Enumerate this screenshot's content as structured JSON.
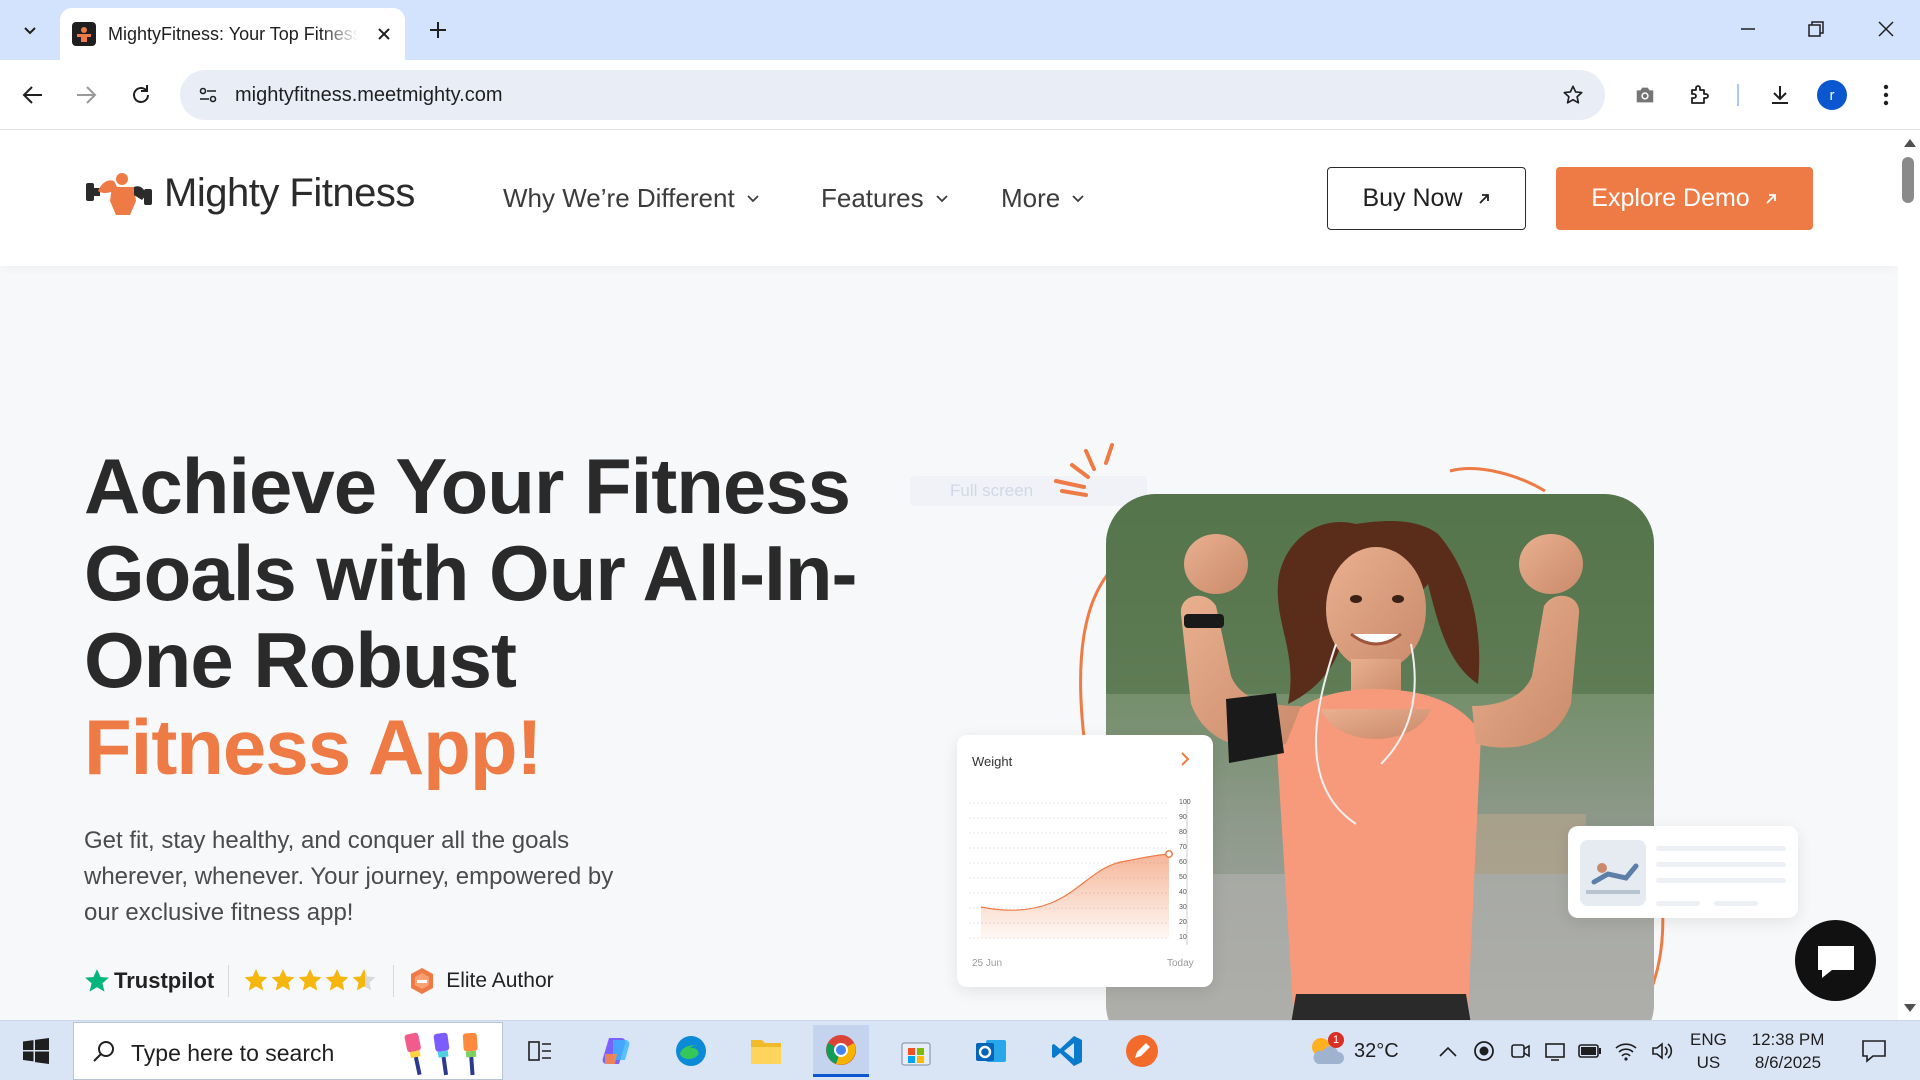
{
  "browser": {
    "tab_title": "MightyFitness: Your Top Fitness App",
    "url": "mightyfitness.meetmighty.com",
    "avatar_letter": "r"
  },
  "site": {
    "logo_text": "Mighty Fitness",
    "nav": [
      {
        "label": "Why We’re Different"
      },
      {
        "label": "Features"
      },
      {
        "label": "More"
      }
    ],
    "buy_now_label": "Buy Now",
    "explore_demo_label": "Explore Demo",
    "accent_color": "#ee7b45"
  },
  "hero": {
    "title_line1": "Achieve Your Fitness Goals with Our All-In-One Robust",
    "title_accent": "Fitness App!",
    "description": "Get fit, stay healthy, and conquer all the goals wherever, whenever. Your journey, empowered by our exclusive fitness app!",
    "trustpilot_label": "Trustpilot",
    "rating_stars": 4.5,
    "elite_author_label": "Elite Author",
    "ghost_label": "Full screen"
  },
  "weight_card": {
    "title": "Weight",
    "y_ticks": [
      "100",
      "90",
      "80",
      "70",
      "60",
      "50",
      "40",
      "30",
      "20",
      "10"
    ],
    "date_start": "25 Jun",
    "date_end": "Today"
  },
  "taskbar": {
    "search_placeholder": "Type here to search",
    "weather_temp": "32°C",
    "weather_badge": "1",
    "lang_line1": "ENG",
    "lang_line2": "US",
    "time": "12:38 PM",
    "date": "8/6/2025"
  }
}
